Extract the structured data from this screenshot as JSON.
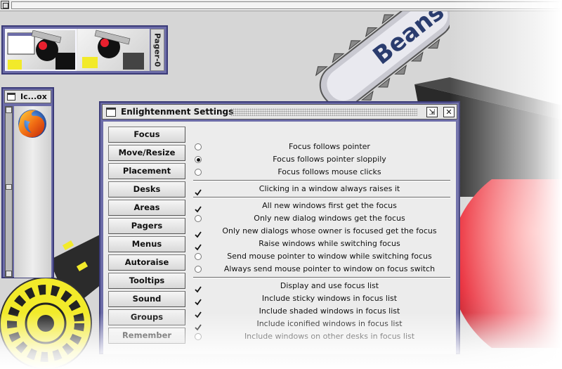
{
  "pager": {
    "label": "Pager-0"
  },
  "iconbox": {
    "title": "Ic...ox"
  },
  "window": {
    "title": "Enlightenment Settings",
    "iconify_glyph": "⇲",
    "close_glyph": "✕"
  },
  "nav": [
    {
      "label": "Focus"
    },
    {
      "label": "Move/Resize"
    },
    {
      "label": "Placement"
    },
    {
      "label": "Desks"
    },
    {
      "label": "Areas"
    },
    {
      "label": "Pagers"
    },
    {
      "label": "Menus"
    },
    {
      "label": "Autoraise"
    },
    {
      "label": "Tooltips"
    },
    {
      "label": "Sound"
    },
    {
      "label": "Groups"
    },
    {
      "label": "Remember"
    }
  ],
  "focus_options": [
    {
      "type": "radio",
      "checked": false,
      "label": "Focus follows pointer"
    },
    {
      "type": "radio",
      "checked": true,
      "label": "Focus follows pointer sloppily"
    },
    {
      "type": "radio",
      "checked": false,
      "label": "Focus follows mouse clicks"
    },
    {
      "type": "sep"
    },
    {
      "type": "check",
      "checked": true,
      "label": "Clicking in a window always raises it"
    },
    {
      "type": "sep"
    },
    {
      "type": "check",
      "checked": true,
      "label": "All new windows first get the focus"
    },
    {
      "type": "radio",
      "checked": false,
      "label": "Only new dialog windows get the focus"
    },
    {
      "type": "check",
      "checked": true,
      "label": "Only new dialogs whose owner is focused get the focus"
    },
    {
      "type": "check",
      "checked": true,
      "label": "Raise windows while switching focus"
    },
    {
      "type": "radio",
      "checked": false,
      "label": "Send mouse pointer to window while switching focus"
    },
    {
      "type": "radio",
      "checked": false,
      "label": "Always send mouse pointer to window on focus switch"
    },
    {
      "type": "sep"
    },
    {
      "type": "check",
      "checked": true,
      "label": "Display and use focus list"
    },
    {
      "type": "check",
      "checked": true,
      "label": "Include sticky windows in focus list"
    },
    {
      "type": "check",
      "checked": true,
      "label": "Include shaded windows in focus list"
    },
    {
      "type": "check",
      "checked": true,
      "label": "Include iconified windows in focus list"
    },
    {
      "type": "radio",
      "checked": false,
      "label": "Include windows on other desks in focus list"
    }
  ],
  "background": {
    "netbeans_text": "Beans"
  },
  "colors": {
    "frame": "#6c6ca8",
    "frame_dark": "#3b3b78",
    "panel": "#ececec",
    "accent_red": "#e8202e",
    "accent_yellow": "#f2ea2a"
  }
}
